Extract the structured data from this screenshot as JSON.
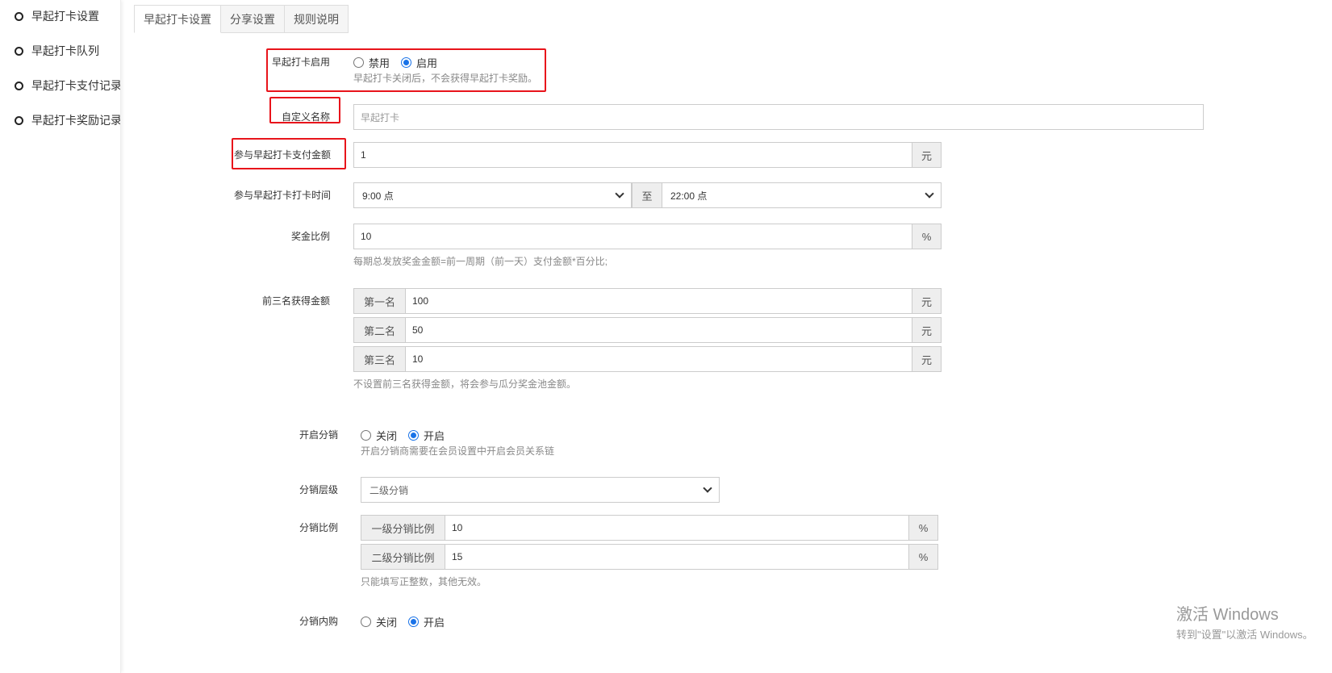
{
  "sidebar": {
    "items": [
      {
        "label": "早起打卡设置"
      },
      {
        "label": "早起打卡队列"
      },
      {
        "label": "早起打卡支付记录"
      },
      {
        "label": "早起打卡奖励记录"
      }
    ]
  },
  "tabs": [
    {
      "label": "早起打卡设置"
    },
    {
      "label": "分享设置"
    },
    {
      "label": "规则说明"
    }
  ],
  "form": {
    "enable": {
      "label": "早起打卡启用",
      "off": "禁用",
      "on": "启用",
      "hint": "早起打卡关闭后，不会获得早起打卡奖励。"
    },
    "custom_name": {
      "label": "自定义名称",
      "placeholder": "早起打卡"
    },
    "pay_amount": {
      "label": "参与早起打卡支付金额",
      "value": "1",
      "unit": "元"
    },
    "time": {
      "label": "参与早起打卡打卡时间",
      "start": "9:00 点",
      "sep": "至",
      "end": "22:00 点"
    },
    "bonus_ratio": {
      "label": "奖金比例",
      "value": "10",
      "unit": "%",
      "hint": "每期总发放奖金金额=前一周期（前一天）支付金额*百分比;"
    },
    "top3": {
      "label": "前三名获得金额",
      "rows": [
        {
          "name": "第一名",
          "value": "100",
          "unit": "元"
        },
        {
          "name": "第二名",
          "value": "50",
          "unit": "元"
        },
        {
          "name": "第三名",
          "value": "10",
          "unit": "元"
        }
      ],
      "hint": "不设置前三名获得金额，将会参与瓜分奖金池金额。"
    },
    "distribution": {
      "label": "开启分销",
      "off": "关闭",
      "on": "开启",
      "hint": "开启分销商需要在会员设置中开启会员关系链"
    },
    "level": {
      "label": "分销层级",
      "value": "二级分销"
    },
    "dist_ratio": {
      "label": "分销比例",
      "rows": [
        {
          "name": "一级分销比例",
          "value": "10",
          "unit": "%"
        },
        {
          "name": "二级分销比例",
          "value": "15",
          "unit": "%"
        }
      ],
      "hint": "只能填写正整数，其他无效。"
    },
    "inner_buy": {
      "label": "分销内购",
      "off": "关闭",
      "on": "开启"
    }
  },
  "watermark": {
    "line1": "激活 Windows",
    "line2": "转到\"设置\"以激活 Windows。"
  },
  "colors": {
    "highlight": "#e8141b",
    "radio_selected": "#1a73e8"
  }
}
